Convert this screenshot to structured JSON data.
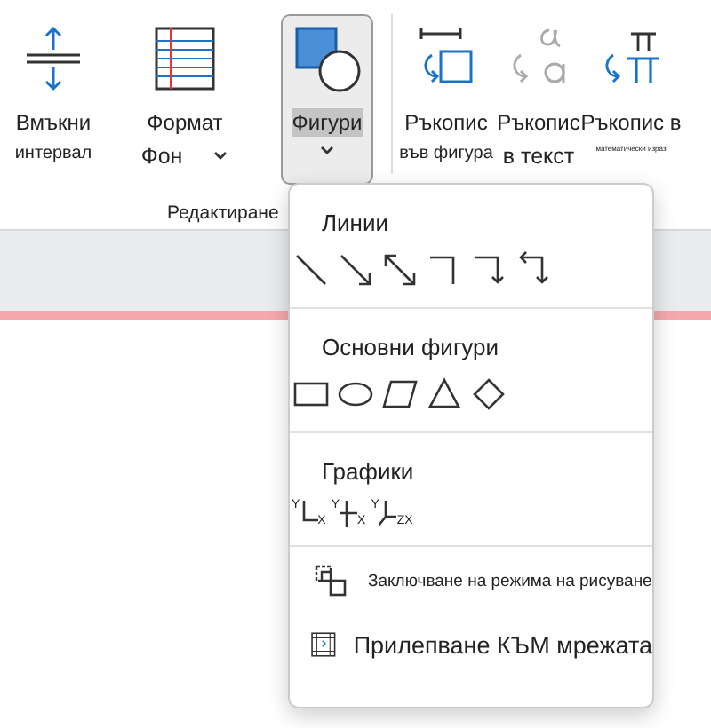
{
  "ribbon": {
    "buttons": [
      {
        "kind": "spacing",
        "label": "Вмъкни",
        "sublabel": "интервал",
        "dropdown": false,
        "selected": false
      },
      {
        "kind": "format",
        "label": "Формат",
        "sublabel": "Фон",
        "dropdown": true,
        "selected": false
      },
      {
        "kind": "shapes",
        "label": "Фигури",
        "dropdown": true,
        "selected": true
      },
      {
        "kind": "ink-shape",
        "label": "Ръкопис",
        "sublabel": "във фигура",
        "dropdown": false,
        "selected": false
      },
      {
        "kind": "ink-text",
        "label": "Ръкопис",
        "sublabel": "в текст",
        "dropdown": false,
        "selected": false
      },
      {
        "kind": "ink-math",
        "label": "Ръкопис в",
        "sublabel": "математически израз",
        "dropdown": false,
        "selected": false
      }
    ],
    "group_label": "Редактиране"
  },
  "menu": {
    "sections": [
      {
        "kind": "lines",
        "title": "Линии"
      },
      {
        "kind": "shapes",
        "title": "Основни фигури"
      },
      {
        "kind": "graphs",
        "title": "Графики",
        "graphs": [
          {
            "axes": [
              "Y",
              "X"
            ]
          },
          {
            "axes": [
              "Y",
              "X"
            ]
          },
          {
            "axes": [
              "Y",
              "Z",
              "X"
            ]
          }
        ]
      }
    ],
    "commands": [
      {
        "kind": "lock",
        "label": "Заключване на режима на рисуване"
      },
      {
        "kind": "snap",
        "label": "Прилепване КЪМ мрежата"
      }
    ]
  }
}
